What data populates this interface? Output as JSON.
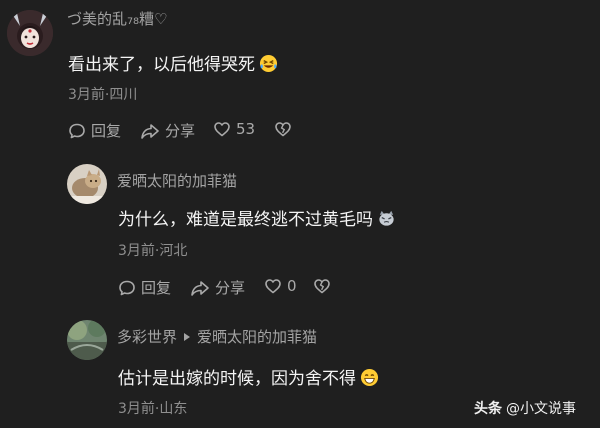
{
  "comments": [
    {
      "user": "づ美的乱₇₈糟♡",
      "text": "看出来了，以后他得哭死",
      "emoji": "laughing-tears-emoji",
      "meta": "3月前·四川",
      "reply_label": "回复",
      "share_label": "分享",
      "like_count": "53"
    },
    {
      "user": "爱晒太阳的加菲猫",
      "text": "为什么，难道是最终逃不过黄毛吗",
      "emoji": "cat-emoji",
      "meta": "3月前·河北",
      "reply_label": "回复",
      "share_label": "分享",
      "like_count": "0"
    },
    {
      "user": "多彩世界",
      "reply_to": "爱晒太阳的加菲猫",
      "text": "估计是出嫁的时候，因为舍不得",
      "emoji": "grinning-emoji",
      "meta": "3月前·山东"
    }
  ],
  "watermark": {
    "brand": "头条",
    "handle": "@小文说事"
  }
}
